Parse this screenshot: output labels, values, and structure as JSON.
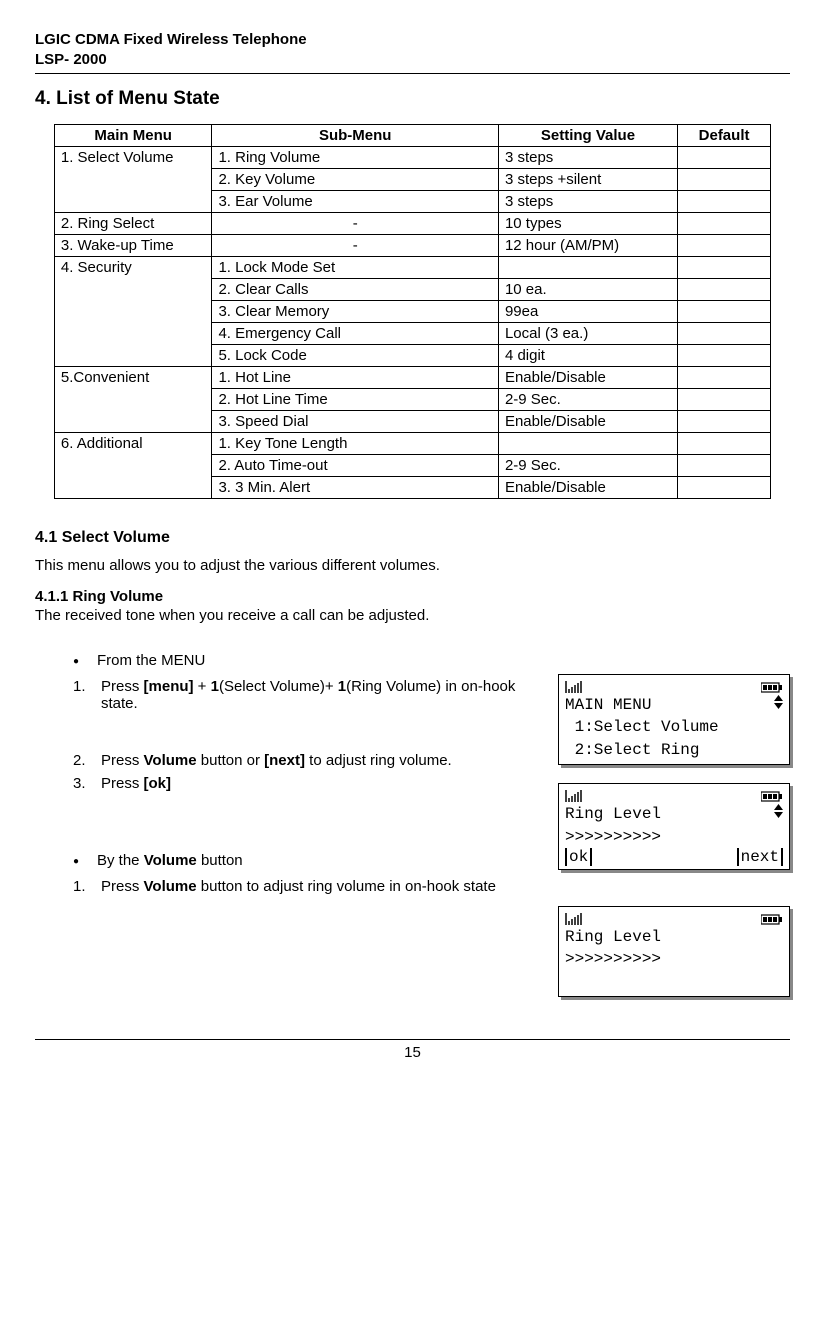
{
  "header": {
    "line1": "LGIC CDMA Fixed Wireless Telephone",
    "line2": "LSP- 2000"
  },
  "section_title": "4. List of Menu State",
  "table": {
    "headers": [
      "Main Menu",
      "Sub-Menu",
      "Setting Value",
      "Default"
    ],
    "rows": [
      {
        "main": "1. Select Volume",
        "sub": "1. Ring Volume",
        "val": "3 steps",
        "def": "",
        "rowspan": 3
      },
      {
        "sub": "2. Key Volume",
        "val": "3 steps +silent",
        "def": ""
      },
      {
        "sub": "3. Ear Volume",
        "val": "3 steps",
        "def": ""
      },
      {
        "main": "2. Ring Select",
        "sub": "-",
        "val": "10 types",
        "def": "",
        "subcenter": true,
        "rowspan": 1
      },
      {
        "main": "3. Wake-up Time",
        "sub": "-",
        "val": "12 hour (AM/PM)",
        "def": "",
        "subcenter": true,
        "rowspan": 1
      },
      {
        "main": "4. Security",
        "sub": "1. Lock Mode Set",
        "val": "",
        "def": "",
        "rowspan": 5
      },
      {
        "sub": "2. Clear Calls",
        "val": "10 ea.",
        "def": ""
      },
      {
        "sub": "3. Clear Memory",
        "val": "99ea",
        "def": ""
      },
      {
        "sub": "4. Emergency Call",
        "val": "Local (3 ea.)",
        "def": ""
      },
      {
        "sub": "5. Lock Code",
        "val": "4 digit",
        "def": ""
      },
      {
        "main": "5.Convenient",
        "sub": "1. Hot Line",
        "val": "Enable/Disable",
        "def": "",
        "rowspan": 3
      },
      {
        "sub": "2. Hot Line Time",
        "val": "2-9 Sec.",
        "def": ""
      },
      {
        "sub": "3. Speed Dial",
        "val": "Enable/Disable",
        "def": ""
      },
      {
        "main": "6. Additional",
        "sub": "1. Key Tone Length",
        "val": "",
        "def": "",
        "rowspan": 3
      },
      {
        "sub": "2. Auto Time-out",
        "val": "2-9 Sec.",
        "def": ""
      },
      {
        "sub": "3. 3 Min. Alert",
        "val": "Enable/Disable",
        "def": ""
      }
    ]
  },
  "sec41": {
    "title": "4.1   Select Volume",
    "text": "This menu allows you to adjust the various different volumes."
  },
  "sec411": {
    "title": "4.1.1  Ring Volume",
    "text": "The received tone when you receive a call can be adjusted.",
    "from_menu": "From the MENU",
    "step1_pre": "Press ",
    "step1_menu": "[menu]",
    "step1_plus1": " + ",
    "step1_one1": "1",
    "step1_mid": "(Select Volume)+ ",
    "step1_one2": "1",
    "step1_post": "(Ring Volume) in on-hook state.",
    "step2_pre": "Press ",
    "step2_vol": "Volume",
    "step2_mid": " button or ",
    "step2_next": "[next]",
    "step2_post": " to adjust ring volume.",
    "step3_pre": "Press ",
    "step3_ok": "[ok]",
    "by_volume_pre": "By the ",
    "by_volume": "Volume",
    "by_volume_post": " button",
    "bv_step1_pre": "Press ",
    "bv_step1_vol": "Volume",
    "bv_step1_post": " button to adjust ring volume in on-hook state"
  },
  "lcd1": {
    "l1": "MAIN MENU",
    "l2": " 1:Select Volume",
    "l3": " 2:Select Ring"
  },
  "lcd2": {
    "l1": "Ring Level",
    "l2": ">>>>>>>>>>",
    "sk1": "ok",
    "sk2": "next"
  },
  "lcd3": {
    "l1": "Ring Level",
    "l2": ">>>>>>>>>>"
  },
  "page_num": "15"
}
